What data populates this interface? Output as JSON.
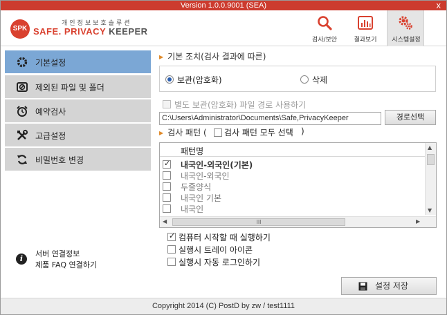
{
  "titlebar": {
    "version": "Version 1.0.0.9001 (SEA)",
    "close": "x"
  },
  "header": {
    "logo_badge": "SPK",
    "logo_korean": "개인정보보호솔루션",
    "logo_safe": "SAFE.",
    "logo_privacy": " PRIVACY",
    "logo_keeper": " KEEPER",
    "nav": [
      {
        "label": "검사/보안",
        "icon": "search-icon"
      },
      {
        "label": "결과보기",
        "icon": "chart-icon"
      },
      {
        "label": "시스템설정",
        "icon": "gear-icon"
      }
    ]
  },
  "sidebar": {
    "items": [
      {
        "label": "기본설정",
        "icon": "gear-icon",
        "active": true
      },
      {
        "label": "제외된 파일 및 폴더",
        "icon": "exclude-icon",
        "active": false
      },
      {
        "label": "예약검사",
        "icon": "alarm-clock-icon",
        "active": false
      },
      {
        "label": "고급설정",
        "icon": "tools-icon",
        "active": false
      },
      {
        "label": "비밀번호 변경",
        "icon": "refresh-icon",
        "active": false
      }
    ],
    "info": {
      "icon": "info-icon",
      "server_link": "서버 연결정보",
      "faq_link": "제품 FAQ 연결하기"
    }
  },
  "main": {
    "action_title": "기본 조치(검사 결과에 따른)",
    "radio_keep": {
      "label": "보관(암호화)",
      "checked": true
    },
    "radio_delete": {
      "label": "삭제",
      "checked": false
    },
    "separate_keep": {
      "label": "별도 보관(암호화) 파일 경로 사용하기",
      "checked": false,
      "disabled": true
    },
    "path_value": "C:\\Users\\Administrator\\Documents\\Safe,PrivacyKeeper",
    "path_button": "경로선택",
    "pattern_title_prefix": "검사 패턴 (",
    "pattern_select_all": "검사 패턴 모두 선택",
    "pattern_title_suffix": ")",
    "pattern_column": "패턴명",
    "patterns": [
      {
        "name": "내국인-외국인(기본)",
        "checked": true
      },
      {
        "name": "내국인-외국인",
        "checked": false
      },
      {
        "name": "두줄양식",
        "checked": false
      },
      {
        "name": "내국인 기본",
        "checked": false
      },
      {
        "name": "내국인",
        "checked": false
      }
    ],
    "hscroll_grip": "III",
    "opt_startup": {
      "label": "컴퓨터 시작할 때 실행하기",
      "checked": true
    },
    "opt_tray": {
      "label": "실행시 트레이 아이콘",
      "checked": false
    },
    "opt_autologin": {
      "label": "실행시 자동 로그인하기",
      "checked": false
    },
    "save_button": "설정 저장"
  },
  "footer": {
    "copyright": "Copyright 2014 (C) PostD by zw / test1111"
  },
  "colors": {
    "brand": "#cc3b2e",
    "active": "#7ba7d5",
    "sidebar": "#d4d4d4",
    "accent": "#e08a2a"
  }
}
